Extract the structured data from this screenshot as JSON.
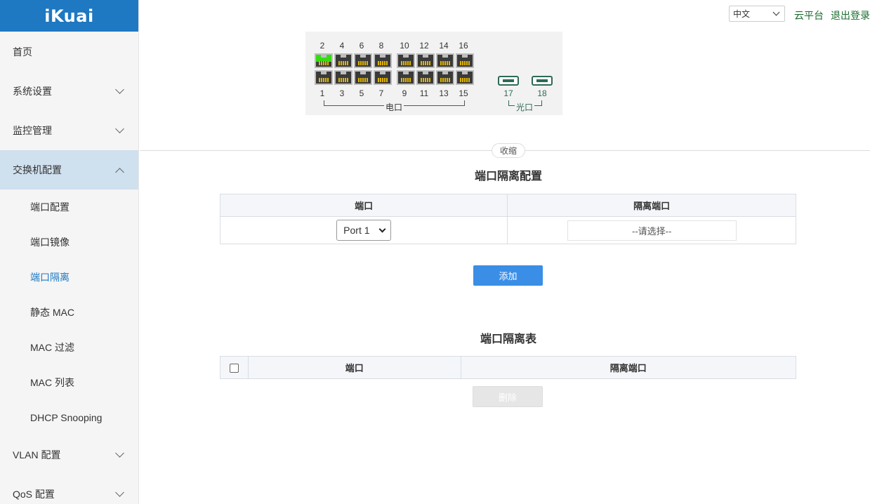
{
  "brand": {
    "logo": "iKuai"
  },
  "sidebar": {
    "items": [
      {
        "label": "首页"
      },
      {
        "label": "系统设置"
      },
      {
        "label": "监控管理"
      },
      {
        "label": "交换机配置"
      },
      {
        "label": "VLAN 配置"
      },
      {
        "label": "QoS 配置"
      }
    ],
    "sub_items": [
      {
        "label": "端口配置"
      },
      {
        "label": "端口镜像"
      },
      {
        "label": "端口隔离"
      },
      {
        "label": "静态 MAC"
      },
      {
        "label": "MAC 过滤"
      },
      {
        "label": "MAC 列表"
      },
      {
        "label": "DHCP Snooping"
      }
    ]
  },
  "header": {
    "language": "中文",
    "cloud_label": "云平台",
    "logout_label": "退出登录"
  },
  "switch_panel": {
    "top_ports": [
      "2",
      "4",
      "6",
      "8",
      "10",
      "12",
      "14",
      "16"
    ],
    "bottom_ports": [
      "1",
      "3",
      "5",
      "7",
      "9",
      "11",
      "13",
      "15"
    ],
    "sfp_ports": [
      "17",
      "18"
    ],
    "electric_label": "电口",
    "optical_label": "光口",
    "active_port": "2",
    "colors": {
      "active": "#33dd11",
      "sfp": "#2d6a55",
      "pins": "#e0b400"
    }
  },
  "collapse_label": "收缩",
  "config": {
    "title": "端口隔离配置",
    "col_port": "端口",
    "col_isolated": "隔离端口",
    "port_value": "Port 1",
    "isolated_placeholder": "--请选择--",
    "add_label": "添加"
  },
  "table": {
    "title": "端口隔离表",
    "col_port": "端口",
    "col_isolated": "隔离端口",
    "delete_label": "删除"
  },
  "colors": {
    "brand": "#1e78c2",
    "primary_button": "#3a8ee6",
    "link": "#1a6b2e"
  }
}
